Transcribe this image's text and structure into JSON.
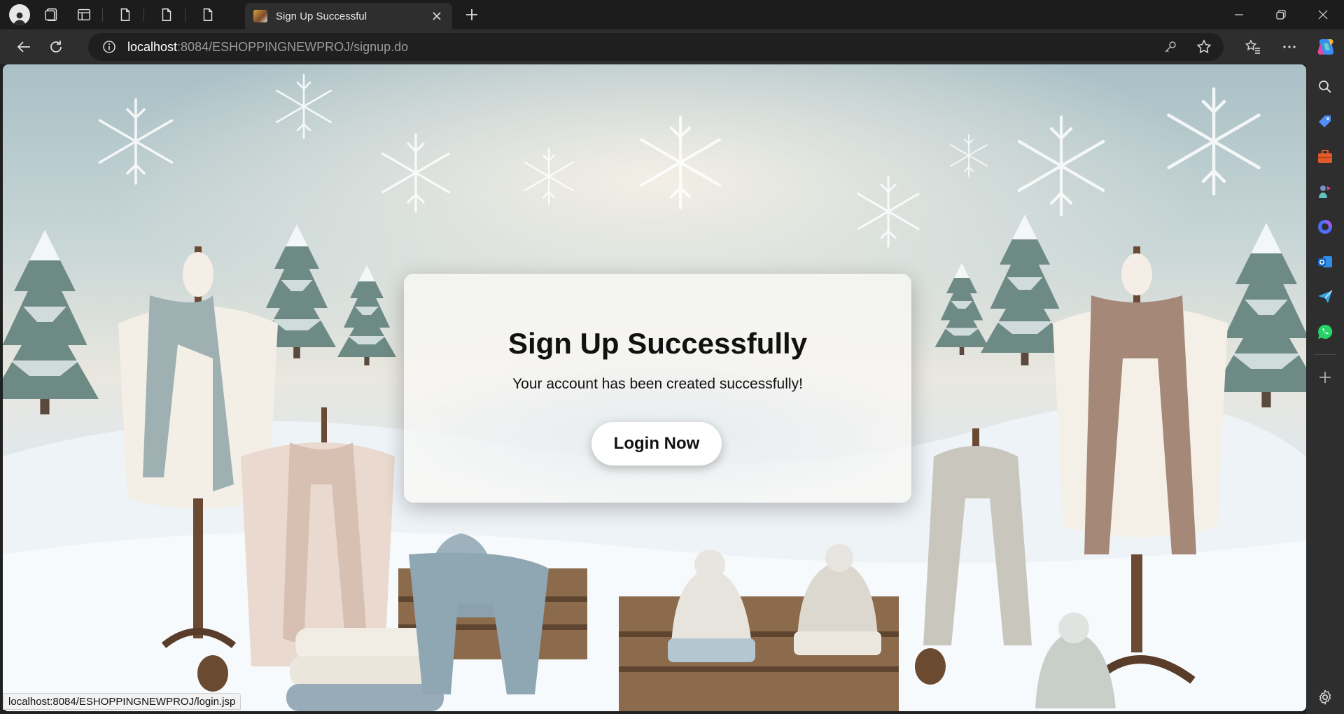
{
  "browser": {
    "tab_title": "Sign Up Successful",
    "url_host": "localhost",
    "url_rest": ":8084/ESHOPPINGNEWPROJ/signup.do",
    "status_url": "localhost:8084/ESHOPPINGNEWPROJ/login.jsp",
    "icons": {
      "profile": "profile-icon",
      "workspaces": "workspaces-icon",
      "tab_actions": "tab-actions-icon",
      "pinned_pages": [
        "page-icon",
        "page-icon",
        "page-icon"
      ],
      "close_tab": "close-icon",
      "new_tab": "plus-icon",
      "minimize": "minimize-icon",
      "restore": "restore-icon",
      "close_window": "close-icon",
      "back": "back-arrow-icon",
      "refresh": "refresh-icon",
      "site_info": "info-icon",
      "key": "key-icon",
      "favorite": "star-icon",
      "favorites": "favorites-icon",
      "more": "more-icon",
      "copilot": "copilot-icon"
    },
    "sidebar": [
      "search-icon",
      "tag-icon",
      "briefcase-icon",
      "games-icon",
      "copilot-icon",
      "outlook-icon",
      "send-icon",
      "whatsapp-icon",
      "plus-icon",
      "settings-icon"
    ]
  },
  "page": {
    "heading": "Sign Up Successfully",
    "message": "Your account has been created successfully!",
    "login_button": "Login Now"
  }
}
